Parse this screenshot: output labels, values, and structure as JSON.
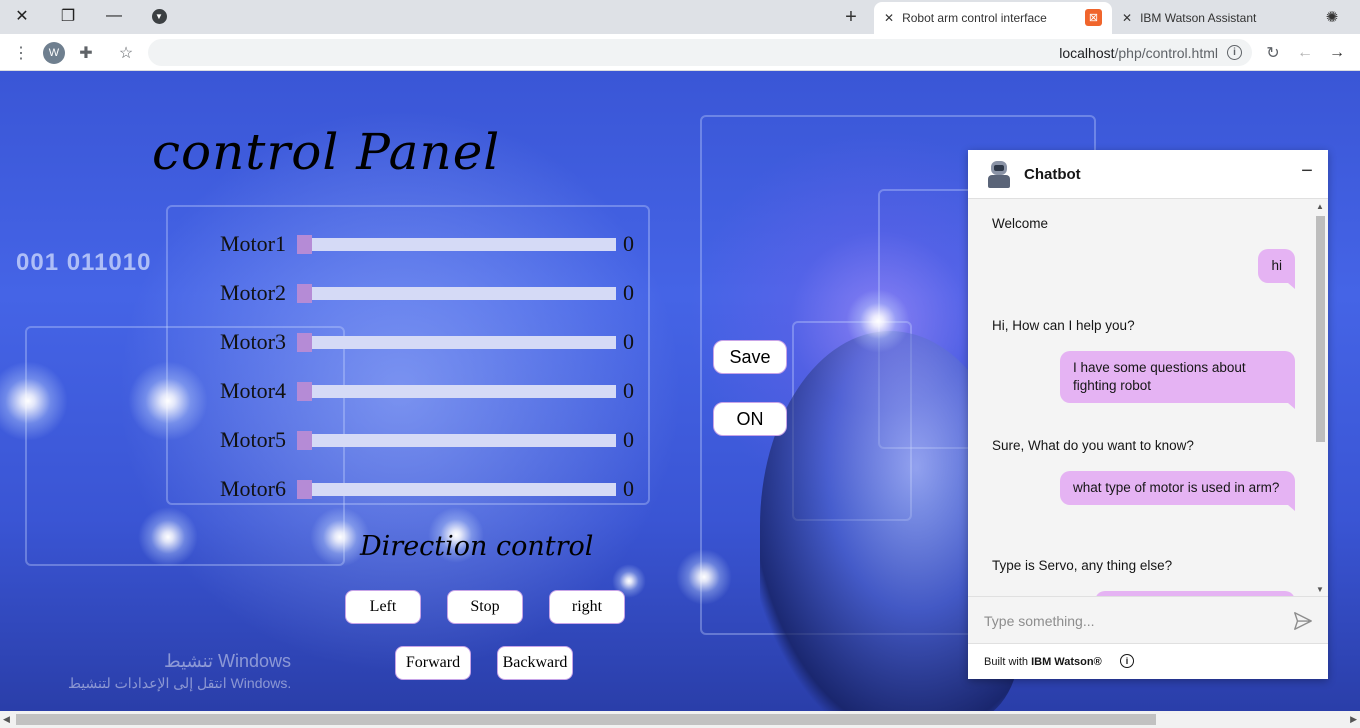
{
  "browser": {
    "tabs": [
      {
        "title": "Robot arm control interface",
        "active": true
      },
      {
        "title": "IBM Watson Assistant",
        "active": false
      }
    ],
    "url_host": "localhost",
    "url_path": "/php/control.html",
    "profile_initial": "W"
  },
  "page": {
    "title": "control Panel",
    "background_text": "001  011010",
    "motors": [
      {
        "label": "Motor1",
        "value": "0"
      },
      {
        "label": "Motor2",
        "value": "0"
      },
      {
        "label": "Motor3",
        "value": "0"
      },
      {
        "label": "Motor4",
        "value": "0"
      },
      {
        "label": "Motor5",
        "value": "0"
      },
      {
        "label": "Motor6",
        "value": "0"
      }
    ],
    "save_label": "Save",
    "on_label": "ON",
    "direction_title": "Direction control",
    "direction_buttons": {
      "left": "Left",
      "stop": "Stop",
      "right": "right",
      "forward": "Forward",
      "backward": "Backward"
    },
    "watermark": {
      "line1": "تنشيط Windows",
      "line2": "انتقل إلى الإعدادات لتنشيط Windows."
    }
  },
  "chatbot": {
    "title": "Chatbot",
    "messages": [
      {
        "from": "bot",
        "text": "Welcome"
      },
      {
        "from": "user",
        "text": "hi"
      },
      {
        "from": "bot",
        "text": "Hi, How can I help you?"
      },
      {
        "from": "user",
        "text": "I have some questions about fighting robot"
      },
      {
        "from": "bot",
        "text": "Sure, What do you want to know?"
      },
      {
        "from": "user",
        "text": "what type of motor is used in arm?"
      },
      {
        "from": "bot",
        "text": "Type is Servo, any thing else?"
      }
    ],
    "input_placeholder": "Type something...",
    "footer_prefix": "Built with ",
    "footer_brand": "IBM Watson®"
  },
  "colors": {
    "accent_purple": "#e5b3f3",
    "slider_thumb": "#b58bd6",
    "page_blue": "#3f5ce0"
  }
}
